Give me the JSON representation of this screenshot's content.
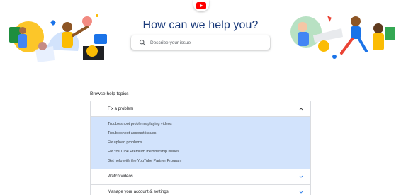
{
  "header": {
    "title": "How can we help you?"
  },
  "search": {
    "placeholder": "Describe your issue"
  },
  "browse": {
    "label": "Browse help topics"
  },
  "topics": [
    {
      "label": "Fix a problem",
      "expanded": true,
      "links": [
        "Troubleshoot problems playing videos",
        "Troubleshoot account issues",
        "Fix upload problems",
        "Fix YouTube Premium membership issues",
        "Get help with the YouTube Partner Program"
      ]
    },
    {
      "label": "Watch videos",
      "expanded": false
    },
    {
      "label": "Manage your account & settings",
      "expanded": false
    }
  ],
  "colors": {
    "brand": "#ff0000",
    "title": "#1a3a7a",
    "chevron": "#1a73e8",
    "expanded_bg": "#d2e3fc"
  },
  "icons": [
    "youtube-logo-icon",
    "search-icon",
    "chevron-up-icon",
    "chevron-down-icon"
  ]
}
